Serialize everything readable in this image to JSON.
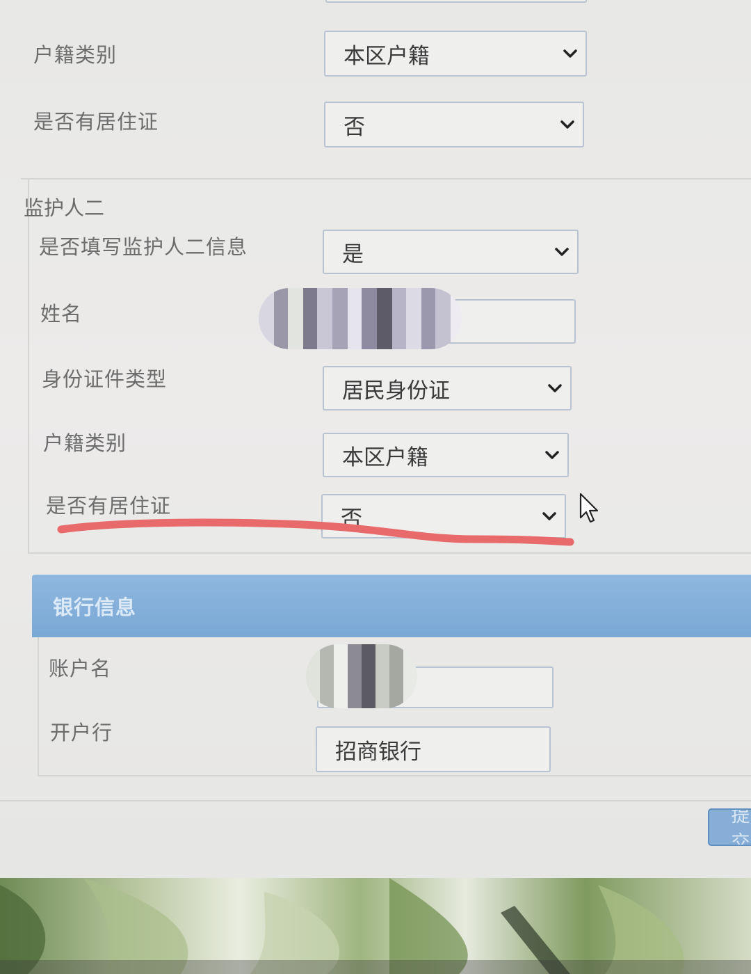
{
  "guardian1": {
    "hukou_label": "户籍类别",
    "hukou_value": "本区户籍",
    "residence_label": "是否有居住证",
    "residence_value": "否"
  },
  "guardian2": {
    "section_title": "监护人二",
    "fill_label": "是否填写监护人二信息",
    "fill_value": "是",
    "name_label": "姓名",
    "name_value": "",
    "id_type_label": "身份证件类型",
    "id_type_value": "居民身份证",
    "hukou_label": "户籍类别",
    "hukou_value": "本区户籍",
    "residence_label": "是否有居住证",
    "residence_value": "否"
  },
  "bank": {
    "section_title": "银行信息",
    "account_name_label": "账户名",
    "account_name_value": "",
    "bank_label": "开户行",
    "bank_value": "招商银行"
  },
  "actions": {
    "submit_label": "提交"
  },
  "colors": {
    "section_bar": "#7aa8d6",
    "annotation_stroke": "#e86a6a",
    "field_border": "#b9c2d0"
  },
  "icons": [
    "chevron-down-icon",
    "mouse-cursor-icon"
  ]
}
